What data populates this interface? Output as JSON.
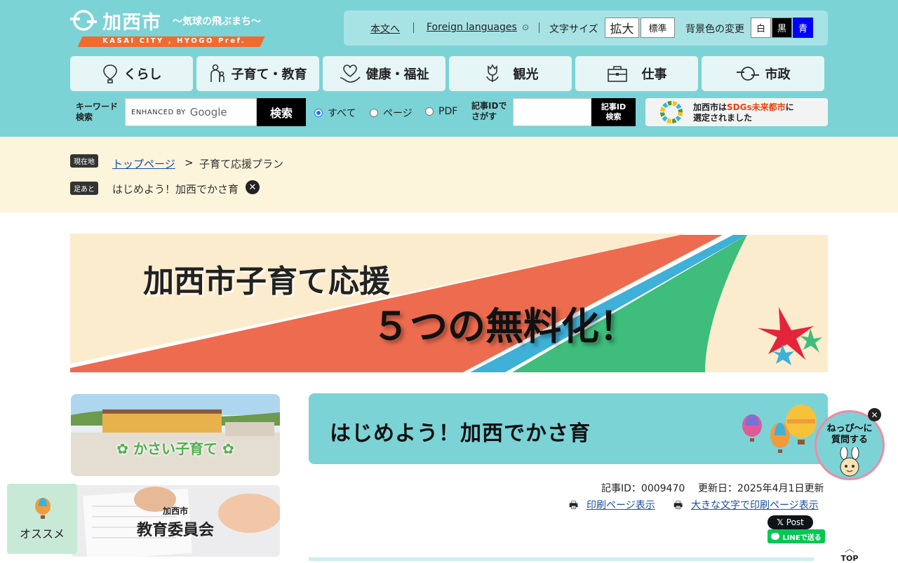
{
  "header": {
    "logo_text": "加西市",
    "logo_tagline": "〜気球の飛ぶまち〜",
    "logo_en": "KASAI CITY , HYOGO Pref.",
    "util": {
      "skip": "本文へ",
      "foreign": "Foreign languages",
      "font_size_label": "文字サイズ",
      "font_large": "拡大",
      "font_normal": "標準",
      "bg_label": "背景色の変更",
      "bg_white": "白",
      "bg_black": "黒",
      "bg_blue": "青"
    },
    "nav": [
      {
        "label": "くらし",
        "icon": "balloon-icon"
      },
      {
        "label": "子育て・教育",
        "icon": "family-icon"
      },
      {
        "label": "健康・福祉",
        "icon": "heart-hand-icon"
      },
      {
        "label": "観光",
        "icon": "tulip-icon"
      },
      {
        "label": "仕事",
        "icon": "briefcase-icon"
      },
      {
        "label": "市政",
        "icon": "city-emblem-icon"
      }
    ],
    "search": {
      "keyword_label_1": "キーワード",
      "keyword_label_2": "検索",
      "placeholder_prefix": "ENHANCED BY",
      "placeholder_brand": "Google",
      "button": "検索",
      "scope_all": "すべて",
      "scope_page": "ページ",
      "scope_pdf": "PDF",
      "id_label_1": "記事IDで",
      "id_label_2": "さがす",
      "id_button_1": "記事ID",
      "id_button_2": "検索"
    },
    "sdgs": {
      "line1_a": "加西市は",
      "line1_b": "SDGs未来都市",
      "line1_c": "に",
      "line2": "選定されました"
    }
  },
  "breadcrumb": {
    "here_tag": "現在地",
    "top": "トップページ",
    "arrow": ">",
    "current": "子育て応援プラン",
    "history_tag": "足あと",
    "history_item": "はじめよう！加西でかさ育"
  },
  "banner": {
    "line1": "加西市子育て応援",
    "line2": "５つの無料化！"
  },
  "sidebar": {
    "card1": "かさい子育て",
    "card2_small": "加西市",
    "card2": "教育委員会"
  },
  "article": {
    "title": "はじめよう！加西でかさ育",
    "id_line": "記事ID：0009470",
    "updated": "更新日：2025年4月1日更新",
    "print": "印刷ページ表示",
    "print_large": "大きな文字で印刷ページ表示",
    "x_post": "Post",
    "line_share": "LINEで送る"
  },
  "floating": {
    "recommend": "オススメ",
    "chat_1": "ねっぴ〜に",
    "chat_2": "質問する",
    "top": "TOP"
  },
  "colors": {
    "header_bg": "#7bd3d6",
    "crumb_bg": "#fdf4dc",
    "logo_orange": "#f26a2e",
    "banner_bg": "#fbeccd"
  }
}
